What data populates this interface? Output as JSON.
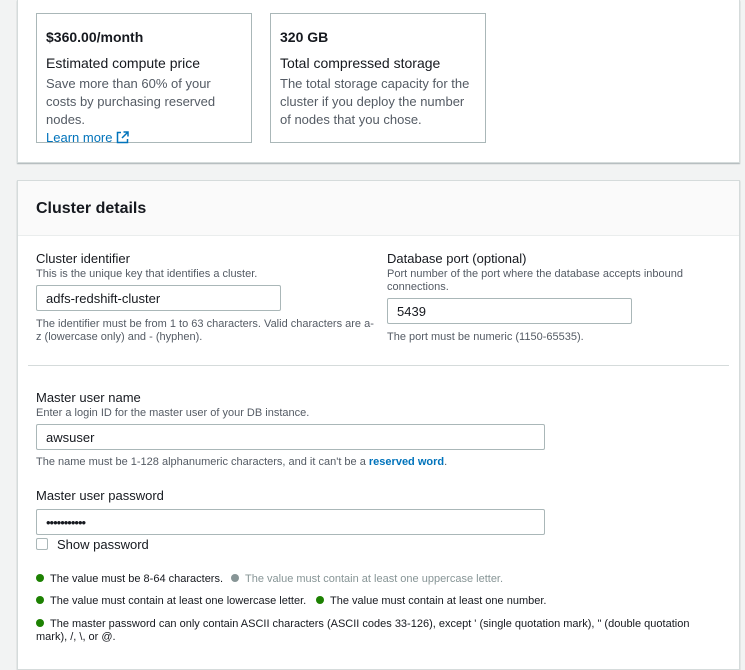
{
  "estimate": {
    "compute_price": "$360.00/month",
    "compute_label": "Estimated compute price",
    "compute_desc": "Save more than 60% of your costs by purchasing reserved nodes.",
    "learn_more": "Learn more",
    "storage_value": "320 GB",
    "storage_label": "Total compressed storage",
    "storage_desc": "The total storage capacity for the cluster if you deploy the number of nodes that you chose."
  },
  "cluster_details": {
    "title": "Cluster details",
    "identifier": {
      "label": "Cluster identifier",
      "description": "This is the unique key that identifies a cluster.",
      "value": "adfs-redshift-cluster",
      "constraint": "The identifier must be from 1 to 63 characters. Valid characters are a-z (lowercase only) and - (hyphen)."
    },
    "port": {
      "label": "Database port (optional)",
      "description": "Port number of the port where the database accepts inbound connections.",
      "value": "5439",
      "constraint": "The port must be numeric (1150-65535)."
    },
    "master_user": {
      "label": "Master user name",
      "description": "Enter a login ID for the master user of your DB instance.",
      "value": "awsuser",
      "constraint_prefix": "The name must be 1-128 alphanumeric characters, and it can't be a ",
      "constraint_link": "reserved word",
      "constraint_suffix": "."
    },
    "master_password": {
      "label": "Master user password",
      "value": "•••••••••••",
      "show_password": "Show password"
    },
    "rules": [
      {
        "text": "The value must be 8-64 characters.",
        "status": "ok"
      },
      {
        "text": "The value must contain at least one uppercase letter.",
        "status": "pending"
      },
      {
        "text": "The value must contain at least one lowercase letter.",
        "status": "ok"
      },
      {
        "text": "The value must contain at least one number.",
        "status": "ok"
      },
      {
        "text": "The master password can only contain ASCII characters (ASCII codes 33-126), except ' (single quotation mark), \" (double quotation mark), /, \\, or @.",
        "status": "ok"
      }
    ]
  },
  "colors": {
    "link": "#0073bb",
    "success_dot": "#1d8102",
    "pending_dot": "#879596"
  }
}
